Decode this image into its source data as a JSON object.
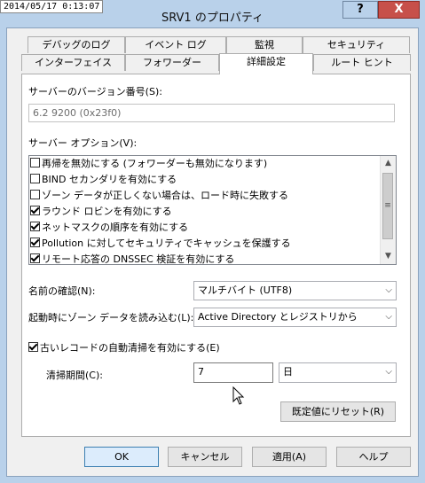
{
  "screen_timestamp": "2014/05/17 0:13:07",
  "window": {
    "title": "SRV1 のプロパティ",
    "help_label": "?",
    "close_label": "X"
  },
  "tabs": {
    "row1": [
      "デバッグのログ",
      "イベント ログ",
      "監視",
      "セキュリティ"
    ],
    "row2": [
      "インターフェイス",
      "フォワーダー",
      "詳細設定",
      "ルート ヒント"
    ],
    "active": "詳細設定"
  },
  "server_version": {
    "label": "サーバーのバージョン番号(S):",
    "value": "6.2 9200 (0x23f0)"
  },
  "server_options": {
    "label": "サーバー オプション(V):",
    "items": [
      {
        "text": "再帰を無効にする (フォワーダーも無効になります)",
        "checked": false
      },
      {
        "text": "BIND セカンダリを有効にする",
        "checked": false
      },
      {
        "text": "ゾーン データが正しくない場合は、ロード時に失敗する",
        "checked": false
      },
      {
        "text": "ラウンド ロビンを有効にする",
        "checked": true
      },
      {
        "text": "ネットマスクの順序を有効にする",
        "checked": true
      },
      {
        "text": "Pollution に対してセキュリティでキャッシュを保護する",
        "checked": true
      },
      {
        "text": "リモート応答の DNSSEC 検証を有効にする",
        "checked": true
      }
    ]
  },
  "name_checking": {
    "label": "名前の確認(N):",
    "value": "マルチバイト (UTF8)"
  },
  "load_zone_data": {
    "label": "起動時にゾーン データを読み込む(L):",
    "value": "Active Directory とレジストリから"
  },
  "scavenging": {
    "checkbox_label": "古いレコードの自動清掃を有効にする(E)",
    "checked": true,
    "period_label": "清掃期間(C):",
    "period_value": "7",
    "period_unit": "日"
  },
  "reset_button": "既定値にリセット(R)",
  "footer_buttons": {
    "ok": "OK",
    "cancel": "キャンセル",
    "apply": "適用(A)",
    "help": "ヘルプ"
  },
  "icons": {
    "check": "checkmark",
    "dropdown": "chevron-down-icon",
    "cursor": "mouse-pointer-icon"
  }
}
